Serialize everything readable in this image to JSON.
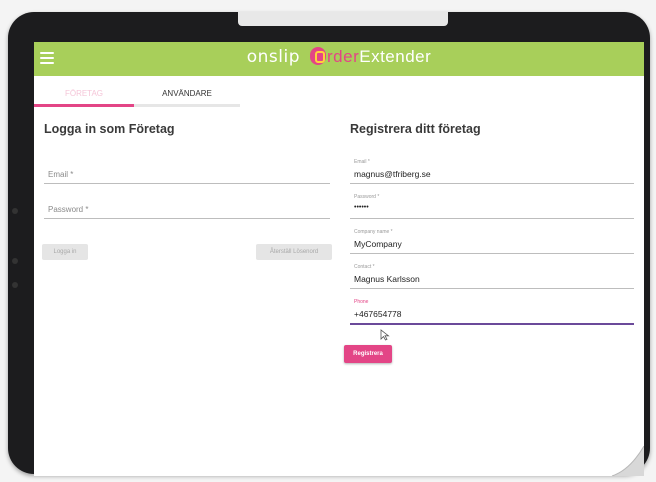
{
  "appbar": {
    "menu_icon": "hamburger-menu-icon",
    "brand_onslip": "onslip",
    "brand_order": "rder",
    "brand_extender": "Extender",
    "accent_color": "#a8cf5a",
    "brand_color": "#e34586"
  },
  "tabs": [
    {
      "label": "FÖRETAG",
      "active": true
    },
    {
      "label": "ANVÄNDARE",
      "active": false
    }
  ],
  "login": {
    "heading": "Logga in som Företag",
    "email_label": "Email *",
    "password_label": "Password *",
    "login_button": "Logga in",
    "reset_button": "Återställ Lösenord"
  },
  "register": {
    "heading": "Registrera ditt företag",
    "fields": [
      {
        "label": "Email *",
        "value": "magnus@tfriberg.se"
      },
      {
        "label": "Password *",
        "value": "••••••"
      },
      {
        "label": "Company name *",
        "value": "MyCompany"
      },
      {
        "label": "Contact *",
        "value": "Magnus Karlsson"
      },
      {
        "label": "Phone",
        "value": "+467654778"
      }
    ],
    "submit_button": "Registrera"
  }
}
